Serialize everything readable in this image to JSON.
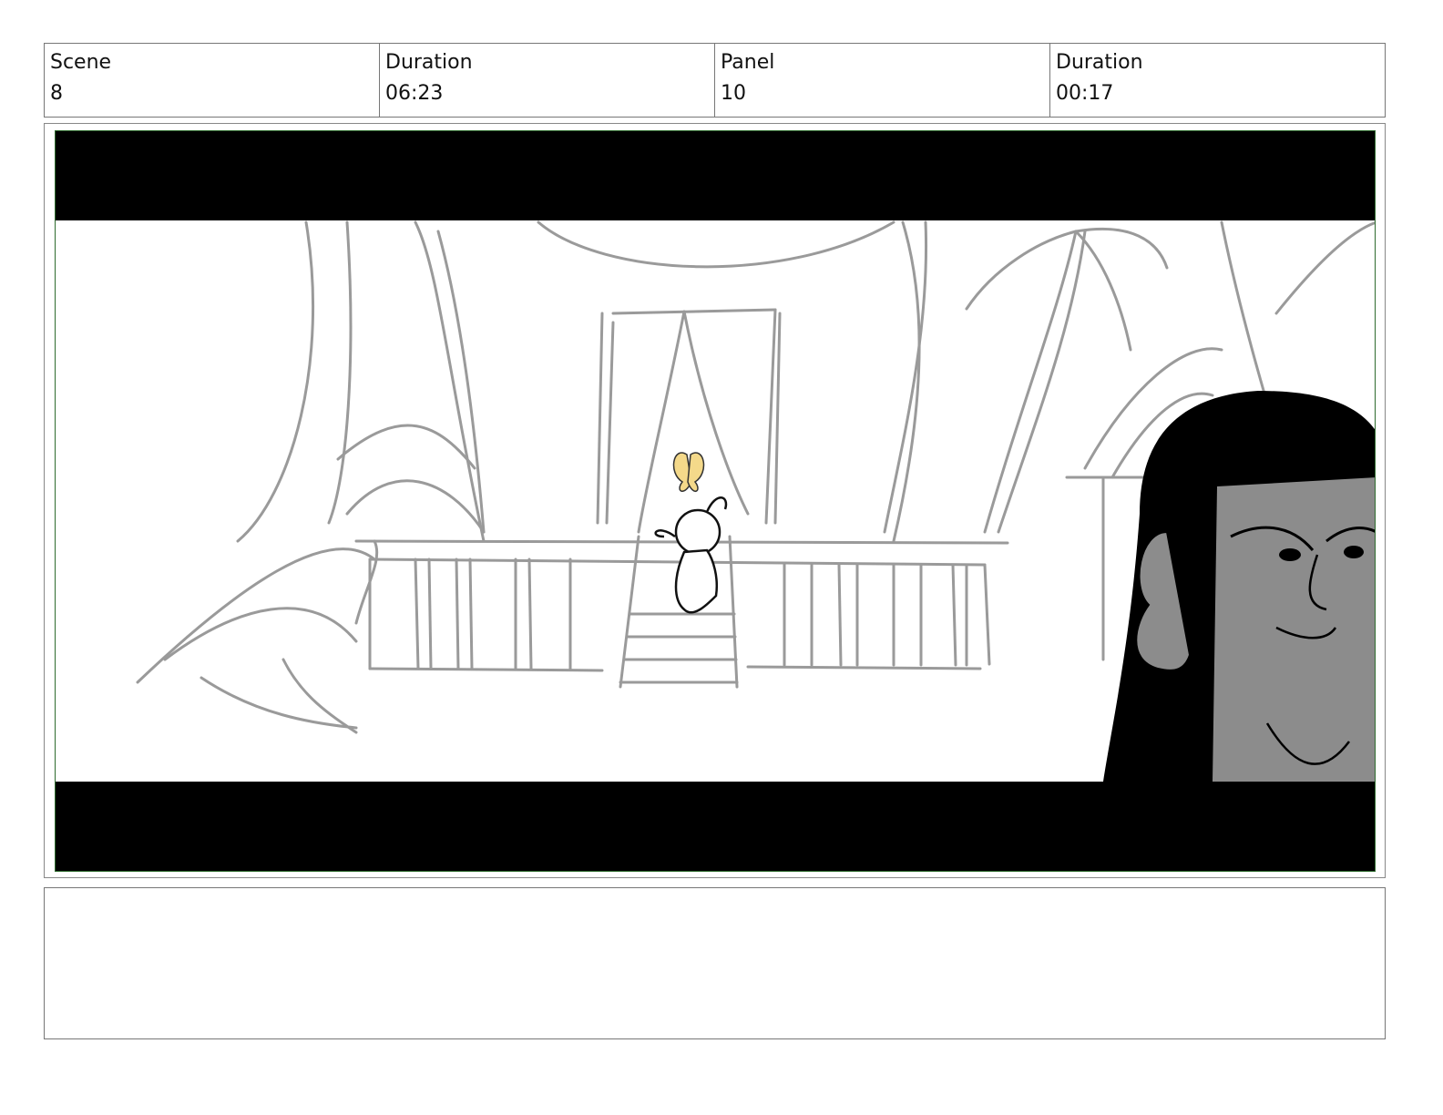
{
  "header": {
    "scene_label": "Scene",
    "scene_value": "8",
    "scene_duration_label": "Duration",
    "scene_duration_value": "06:23",
    "panel_label": "Panel",
    "panel_value": "10",
    "panel_duration_label": "Duration",
    "panel_duration_value": "00:17"
  },
  "notes": {
    "text": ""
  },
  "colors": {
    "frame_border": "#2e6b2e",
    "sketch_line": "#9a9a9a",
    "butterfly": "#f4d98a",
    "character_fill": "#8c8c8c"
  }
}
